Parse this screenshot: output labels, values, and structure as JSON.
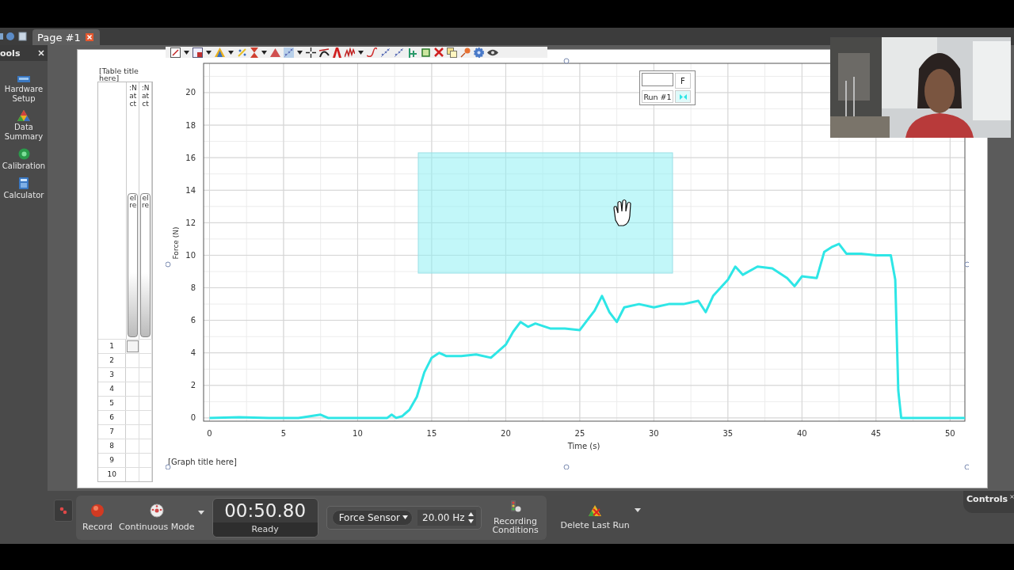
{
  "tab": {
    "title": "Page #1",
    "selected": true
  },
  "tools_panel": {
    "title": "ools",
    "items": [
      {
        "label": "Hardware Setup",
        "kind": "hardware"
      },
      {
        "label": "Data Summary",
        "kind": "summary"
      },
      {
        "label": "Calibration",
        "kind": "calibration"
      },
      {
        "label": "Calculator",
        "kind": "calculator"
      }
    ]
  },
  "table": {
    "title": "[Table title here]",
    "columns": [
      {
        "header": ":N at ct",
        "button": "el re"
      },
      {
        "header": ":N at ct",
        "button": "el re"
      }
    ],
    "rows": [
      {
        "label": "1",
        "selected": true
      },
      {
        "label": "2",
        "selected": false
      },
      {
        "label": "3",
        "selected": false
      },
      {
        "label": "4",
        "selected": false
      },
      {
        "label": "5",
        "selected": false
      },
      {
        "label": "6",
        "selected": false
      },
      {
        "label": "7",
        "selected": false
      },
      {
        "label": "8",
        "selected": false
      },
      {
        "label": "9",
        "selected": false
      },
      {
        "label": "10",
        "selected": false
      }
    ]
  },
  "graph": {
    "legend": {
      "column_label": "F"
    },
    "chart_data": {
      "type": "line",
      "grid": true,
      "title": "[Graph title here]",
      "xlabel": "Time (s)",
      "ylabel": "Force (N)",
      "x": [
        0,
        2,
        4,
        6,
        7.5,
        8,
        10,
        12,
        12.3,
        12.6,
        13,
        13.5,
        14,
        14.5,
        15,
        15.5,
        16,
        17,
        18,
        19,
        20,
        20.5,
        21,
        21.5,
        22,
        23,
        24,
        25,
        25.5,
        26,
        26.5,
        27,
        27.5,
        28,
        29,
        30,
        31,
        32,
        33,
        33.5,
        34,
        34.5,
        35,
        35.5,
        36,
        37,
        38,
        39,
        39.5,
        40,
        41,
        41.5,
        42,
        42.5,
        43,
        44,
        45,
        46,
        46.3,
        46.5,
        46.7,
        48,
        51
      ],
      "series": [
        {
          "name": "Run #1",
          "color": "#2ee6e6",
          "values": [
            0,
            0.05,
            0,
            0,
            0.2,
            0,
            0,
            0,
            0.2,
            0,
            0.1,
            0.5,
            1.3,
            2.8,
            3.7,
            4,
            3.8,
            3.8,
            3.9,
            3.7,
            4.5,
            5.3,
            5.9,
            5.6,
            5.8,
            5.5,
            5.5,
            5.4,
            6,
            6.6,
            7.5,
            6.5,
            5.9,
            6.8,
            7,
            6.8,
            7,
            7,
            7.2,
            6.5,
            7.5,
            8,
            8.5,
            9.3,
            8.8,
            9.3,
            9.2,
            8.6,
            8.1,
            8.7,
            8.6,
            10.2,
            10.5,
            10.7,
            10.1,
            10.1,
            10,
            10,
            8.5,
            1.7,
            0,
            0,
            0
          ]
        }
      ],
      "xlim": [
        -0.4,
        51
      ],
      "ylim": [
        -0.2,
        21.8
      ],
      "xticks": [
        0,
        5,
        10,
        15,
        20,
        25,
        30,
        35,
        40,
        45,
        50
      ],
      "yticks": [
        0,
        2,
        4,
        6,
        8,
        10,
        12,
        14,
        16,
        18,
        20
      ]
    }
  },
  "controls": {
    "record": "Record",
    "mode": "Continuous Mode",
    "timer": "00:50.80",
    "status": "Ready",
    "sensor": "Force Sensor",
    "rate": "20.00 Hz",
    "conditions": "Recording Conditions",
    "delete": "Delete Last Run",
    "panel_title": "Controls"
  }
}
